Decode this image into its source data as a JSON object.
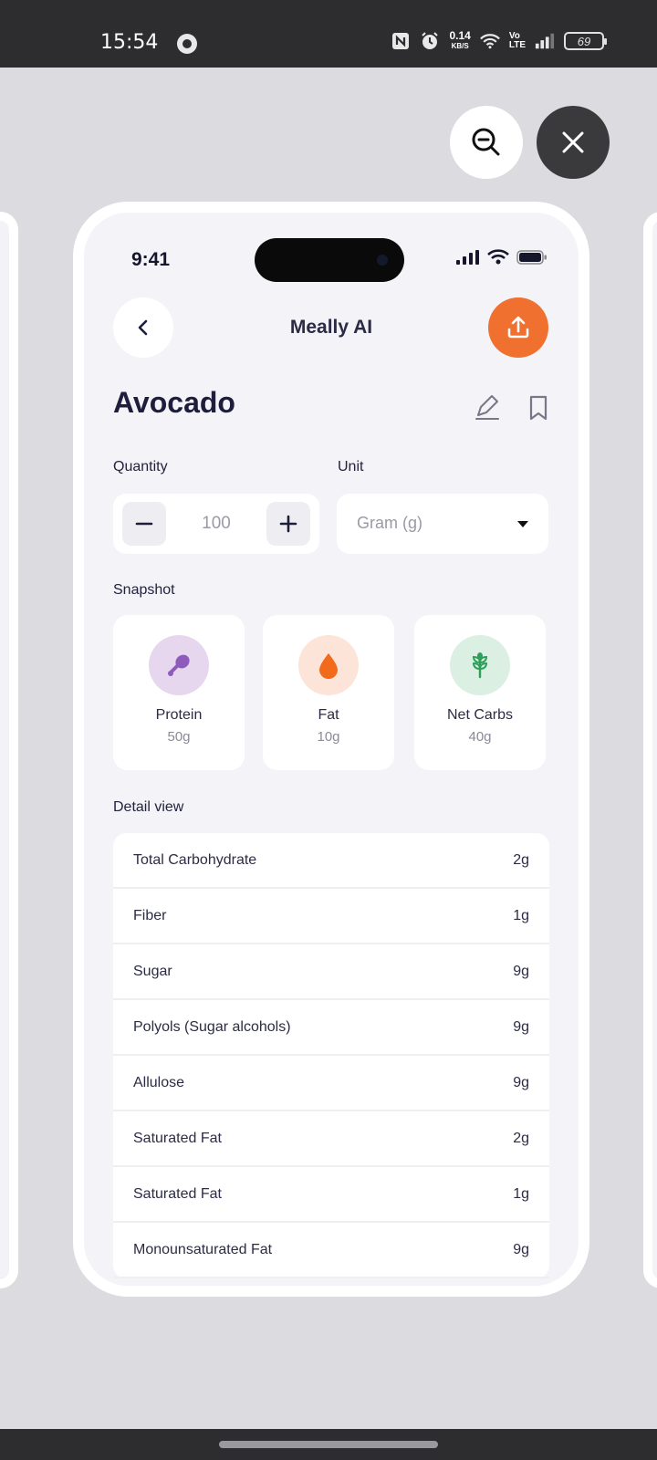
{
  "system_status": {
    "time": "15:54",
    "net_speed_value": "0.14",
    "net_speed_unit": "KB/S",
    "volte_top": "Vo",
    "volte_bottom": "LTE",
    "battery": "69"
  },
  "phone": {
    "time": "9:41",
    "header": {
      "title": "Meally AI"
    },
    "food_name": "Avocado",
    "quantity": {
      "label": "Quantity",
      "value": "100"
    },
    "unit": {
      "label": "Unit",
      "value": "Gram (g)"
    },
    "snapshot": {
      "label": "Snapshot",
      "items": [
        {
          "name": "Protein",
          "value": "50g",
          "icon": "drumstick-icon",
          "bg": "#e6d7ee",
          "fg": "#8e5bbd"
        },
        {
          "name": "Fat",
          "value": "10g",
          "icon": "drop-icon",
          "bg": "#fde4d8",
          "fg": "#f26a1b"
        },
        {
          "name": "Net Carbs",
          "value": "40g",
          "icon": "wheat-icon",
          "bg": "#dbefe3",
          "fg": "#2e9e5b"
        }
      ]
    },
    "detail": {
      "label": "Detail view",
      "rows": [
        {
          "name": "Total Carbohydrate",
          "value": "2g"
        },
        {
          "name": "Fiber",
          "value": "1g"
        },
        {
          "name": "Sugar",
          "value": "9g"
        },
        {
          "name": "Polyols (Sugar alcohols)",
          "value": "9g"
        },
        {
          "name": "Allulose",
          "value": "9g"
        },
        {
          "name": "Saturated Fat",
          "value": "2g"
        },
        {
          "name": "Saturated Fat",
          "value": "1g"
        },
        {
          "name": "Monounsaturated Fat",
          "value": "9g"
        }
      ]
    }
  },
  "colors": {
    "accent": "#f07030",
    "background": "#dcdce0",
    "screen": "#f3f3f8"
  }
}
